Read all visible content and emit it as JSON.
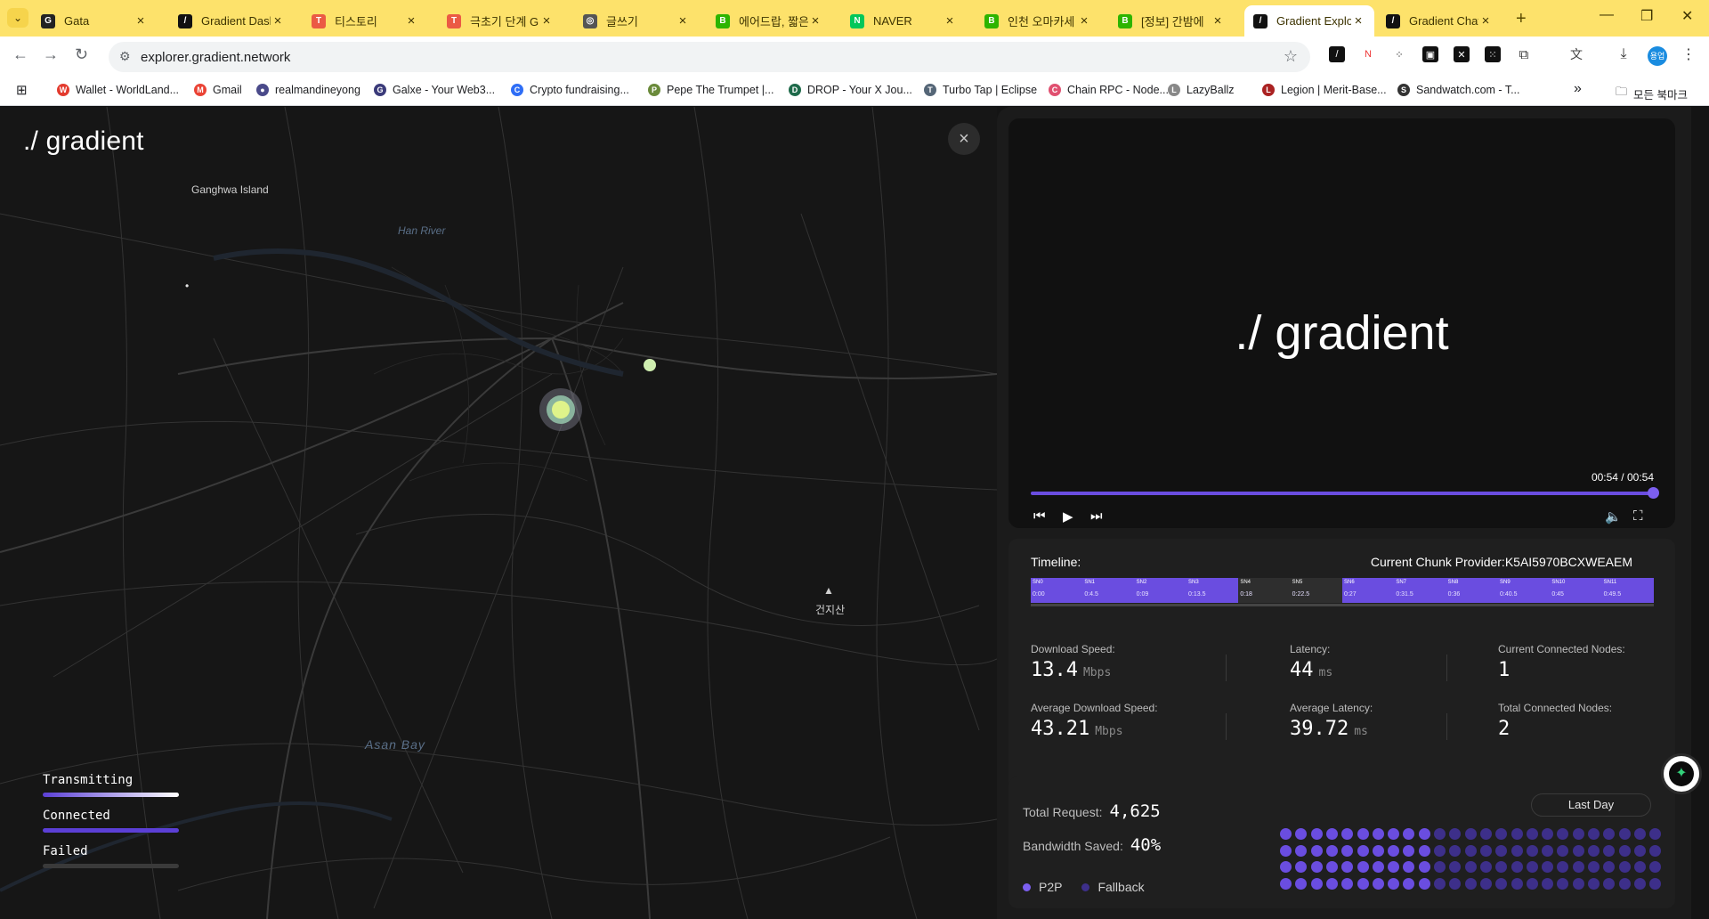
{
  "tabs": [
    {
      "title": "Gata",
      "fav_color": "#222222",
      "fav_glyph": "G"
    },
    {
      "title": "Gradient Dash",
      "fav_color": "#111111",
      "fav_glyph": "/"
    },
    {
      "title": "티스토리",
      "fav_color": "#eb5a44",
      "fav_glyph": "T"
    },
    {
      "title": "극초기 단계 Gr",
      "fav_color": "#eb5a44",
      "fav_glyph": "T"
    },
    {
      "title": "글쓰기",
      "fav_color": "#555555",
      "fav_glyph": "◎"
    },
    {
      "title": "에어드랍, 짧은",
      "fav_color": "#2db400",
      "fav_glyph": "B"
    },
    {
      "title": "NAVER",
      "fav_color": "#03c75a",
      "fav_glyph": "N"
    },
    {
      "title": "인천 오마카세",
      "fav_color": "#2db400",
      "fav_glyph": "B"
    },
    {
      "title": "[정보] 간밤에",
      "fav_color": "#2db400",
      "fav_glyph": "B"
    },
    {
      "title": "Gradient Explo",
      "fav_color": "#111111",
      "fav_glyph": "/"
    },
    {
      "title": "Gradient Chat",
      "fav_color": "#111111",
      "fav_glyph": "/"
    }
  ],
  "toolbar": {
    "url": "explorer.gradient.network",
    "profile_label": "용업"
  },
  "bookmarks": [
    {
      "title": "Wallet - WorldLand...",
      "color": "#e33b2e",
      "glyph": "W"
    },
    {
      "title": "Gmail",
      "color": "#ea4335",
      "glyph": "M"
    },
    {
      "title": "realmandineyong",
      "color": "#4a4a8a",
      "glyph": "●"
    },
    {
      "title": "Galxe - Your Web3...",
      "color": "#3b3b7a",
      "glyph": "G"
    },
    {
      "title": "Crypto fundraising...",
      "color": "#2f6ef6",
      "glyph": "C"
    },
    {
      "title": "Pepe The Trumpet |...",
      "color": "#6a8a3a",
      "glyph": "P"
    },
    {
      "title": "DROP - Your X Jou...",
      "color": "#1e6a4a",
      "glyph": "D"
    },
    {
      "title": "Turbo Tap | Eclipse",
      "color": "#556677",
      "glyph": "T"
    },
    {
      "title": "Chain RPC - Node...",
      "color": "#e05070",
      "glyph": "C"
    },
    {
      "title": "LazyBallz",
      "color": "#888888",
      "glyph": "L"
    },
    {
      "title": "Legion | Merit-Base...",
      "color": "#aa2222",
      "glyph": "L"
    },
    {
      "title": "Sandwatch.com - T...",
      "color": "#333333",
      "glyph": "S"
    }
  ],
  "bookmarks_more": "»",
  "bookmarks_all": "모든 북마크",
  "page": {
    "logo": "./ gradient",
    "map_labels": {
      "ganghwa": "Ganghwa Island",
      "han_river": "Han River",
      "asan_bay": "Asan Bay",
      "mountain": "건지산"
    },
    "legend": [
      {
        "label": "Transmitting"
      },
      {
        "label": "Connected"
      },
      {
        "label": "Failed"
      }
    ]
  },
  "video": {
    "logo": "./ gradient",
    "time": "00:54 / 00:54",
    "progress": 1.0
  },
  "timeline": {
    "label": "Timeline:",
    "provider_label": "Current Chunk Provider:",
    "provider_id": "K5AI5970BCXWEAEM",
    "chunks": [
      {
        "name": "SN0",
        "time": "0:00",
        "active": true
      },
      {
        "name": "SN1",
        "time": "0:4.5",
        "active": true
      },
      {
        "name": "SN2",
        "time": "0:09",
        "active": true
      },
      {
        "name": "SN3",
        "time": "0:13.5",
        "active": true
      },
      {
        "name": "SN4",
        "time": "0:18",
        "active": false
      },
      {
        "name": "SN5",
        "time": "0:22.5",
        "active": false
      },
      {
        "name": "SN6",
        "time": "0:27",
        "active": true
      },
      {
        "name": "SN7",
        "time": "0:31.5",
        "active": true
      },
      {
        "name": "SN8",
        "time": "0:36",
        "active": true
      },
      {
        "name": "SN9",
        "time": "0:40.5",
        "active": true
      },
      {
        "name": "SN10",
        "time": "0:45",
        "active": true
      },
      {
        "name": "SN11",
        "time": "0:49.5",
        "active": true
      }
    ]
  },
  "stats": {
    "download_label": "Download Speed:",
    "download_value": "13.4",
    "download_unit": "Mbps",
    "latency_label": "Latency:",
    "latency_value": "44",
    "latency_unit": "ms",
    "cur_nodes_label": "Current Connected Nodes:",
    "cur_nodes_value": "1",
    "avg_download_label": "Average Download Speed:",
    "avg_download_value": "43.21",
    "avg_download_unit": "Mbps",
    "avg_latency_label": "Average Latency:",
    "avg_latency_value": "39.72",
    "avg_latency_unit": "ms",
    "total_nodes_label": "Total Connected Nodes:",
    "total_nodes_value": "2"
  },
  "requests": {
    "total_label": "Total Request:",
    "total_value": "4,625",
    "bandwidth_label": "Bandwidth Saved:",
    "bandwidth_value": "40%",
    "range_button": "Last Day",
    "legend_p2p": "P2P",
    "legend_fallback": "Fallback",
    "dot_grid": {
      "rows": 4,
      "cols": 25,
      "p2p_percent": 40
    }
  },
  "colors": {
    "accent": "#6a4de0",
    "accent_light": "#8a72ff",
    "fallback": "#3d2f8a",
    "tabbar": "#fde26b"
  }
}
